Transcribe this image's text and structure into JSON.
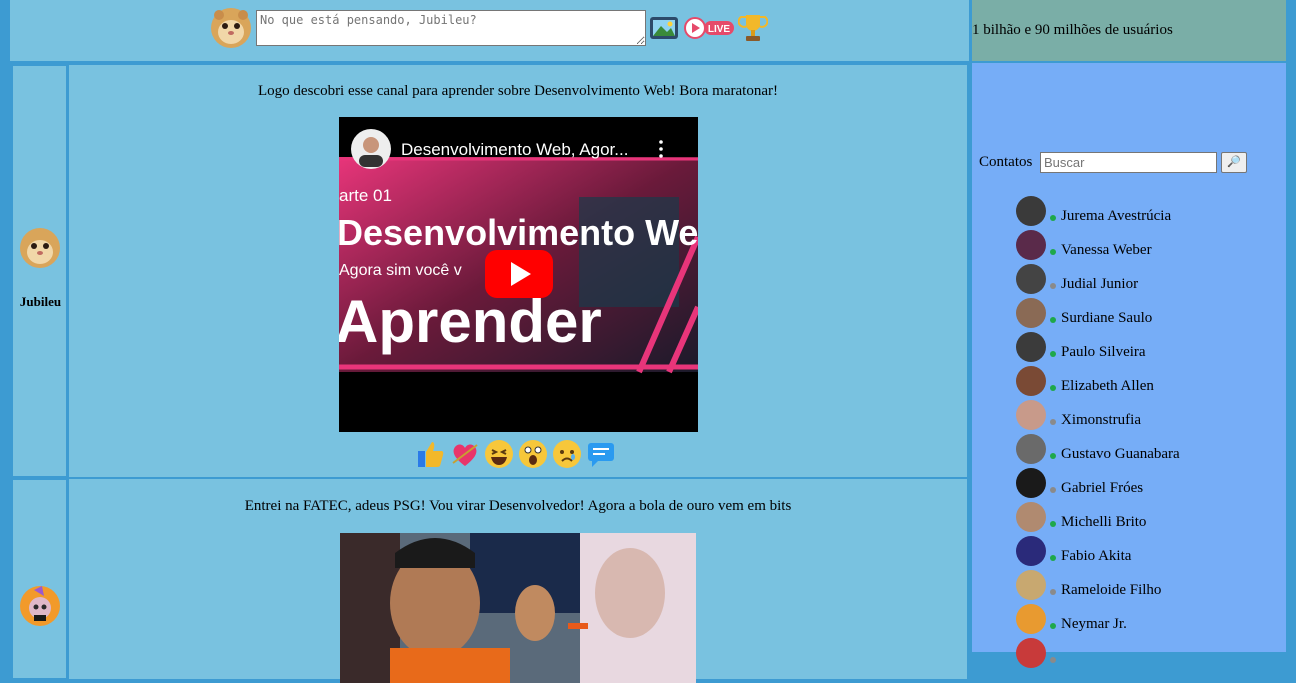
{
  "header": {
    "status_placeholder": "No que está pensando, Jubileu?",
    "user_count": "1 bilhão e 90 milhões de usuários",
    "icons": [
      "profile-avatar",
      "photo-icon",
      "live-icon",
      "trophy-icon"
    ],
    "live_label": "LIVE"
  },
  "posts": [
    {
      "author": "Jubileu",
      "text": "Logo descobri esse canal para aprender sobre Desenvolvimento Web! Bora maratonar!",
      "video": {
        "title": "Desenvolvimento Web, Agor...",
        "badge": "arte 01",
        "headline1": "Desenvolvimento Web",
        "headline2": "Agora sim você v",
        "headline3": "Aprender"
      },
      "reactions": [
        "like-icon",
        "heart-icon",
        "laugh-icon",
        "wow-icon",
        "sad-icon",
        "comment-icon"
      ]
    },
    {
      "author": "",
      "text": "Entrei na FATEC, adeus PSG! Vou virar Desenvolvedor! Agora a bola de ouro vem em bits"
    }
  ],
  "sidebar": {
    "contacts_label": "Contatos",
    "search_placeholder": "Buscar",
    "search_button": "🔎",
    "contacts": [
      {
        "name": "Jurema Avestrúcia",
        "online": true,
        "color": "#3a3a3a"
      },
      {
        "name": "Vanessa Weber",
        "online": true,
        "color": "#5a2a4a"
      },
      {
        "name": "Judial Junior",
        "online": false,
        "color": "#444444"
      },
      {
        "name": "Surdiane Saulo",
        "online": true,
        "color": "#8a6a55"
      },
      {
        "name": "Paulo Silveira",
        "online": true,
        "color": "#3b3b3b"
      },
      {
        "name": "Elizabeth Allen",
        "online": true,
        "color": "#7a4a35"
      },
      {
        "name": "Ximonstrufia",
        "online": false,
        "color": "#c89a8a"
      },
      {
        "name": "Gustavo Guanabara",
        "online": true,
        "color": "#6a6a6a"
      },
      {
        "name": "Gabriel Fróes",
        "online": false,
        "color": "#1a1a1a"
      },
      {
        "name": "Michelli Brito",
        "online": true,
        "color": "#b08a70"
      },
      {
        "name": "Fabio Akita",
        "online": true,
        "color": "#2a2a7a"
      },
      {
        "name": "Rameloide Filho",
        "online": false,
        "color": "#c8a870"
      },
      {
        "name": "Neymar Jr.",
        "online": true,
        "color": "#e89a30"
      },
      {
        "name": "",
        "online": false,
        "color": "#c83a3a"
      }
    ],
    "online_color": "#1fa84a",
    "offline_color": "#8a8a8a"
  }
}
